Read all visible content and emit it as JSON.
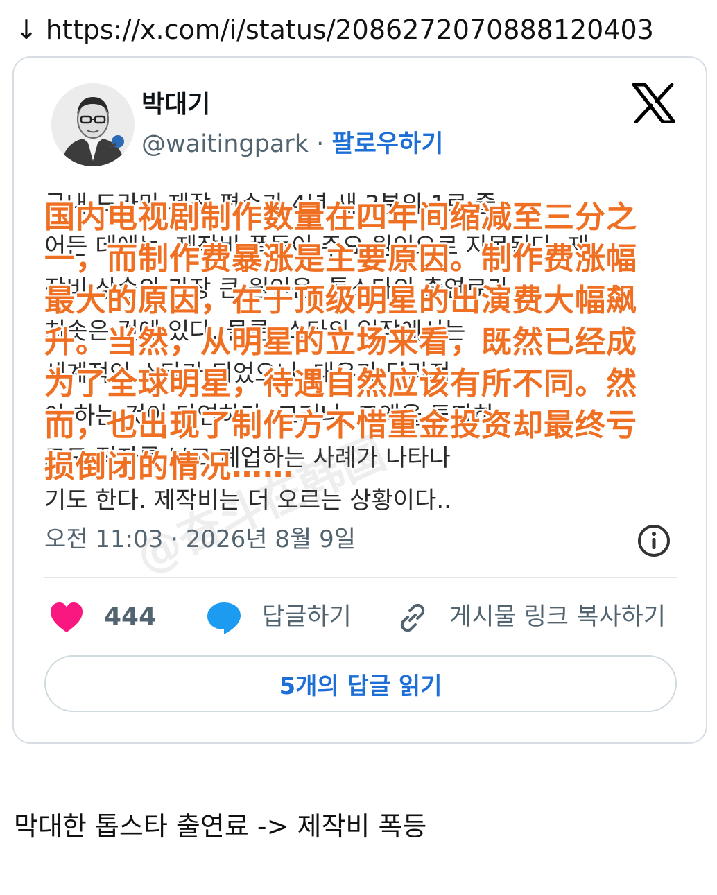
{
  "header": {
    "arrow": "↓",
    "url": "https://x.com/i/status/2086272070888120403"
  },
  "tweet": {
    "display_name": "박대기",
    "handle": "@waitingpark",
    "separator": "·",
    "follow_label": "팔로우하기",
    "background_text_lines": [
      "국내 드라마 제작 편수가 4년 새 3분의 1로 줄",
      "어든 데에는, 제작비 폭등이 주요 원인으로 지목된다. 제",
      "작비 상승의 가장 큰 원인은, 톱스타의 출연료가",
      "치솟은 것에 있다. 물론, 스타의 입장에서는",
      "세계적인 스타가 되었으니, 대우가 달라져",
      "야 하는 것이 당연하다. 그러나, 고액을 투자하",
      "고도 적자를 보고 폐업하는 사례가 나타나",
      "기도 한다. 제작비는 더 오르는 상황이다.."
    ],
    "overlay_text": "国内电视剧制作数量在四年间缩减至三分之一，而制作费暴涨是主要原因。制作费涨幅最大的原因，在于顶级明星的出演费大幅飙升。当然，从明星的立场来看，既然已经成为了全球明星，待遇自然应该有所不同。然而，也出现了制作方不惜重金投资却最终亏损倒闭的情况……",
    "timestamp": "오전 11:03 · 2026년 8월 9일",
    "like_count": "444",
    "reply_label": "답글하기",
    "copy_link_label": "게시물 링크 복사하기",
    "read_replies_label": "5개의 답글 읽기",
    "watermark": "@奋斗在韩国"
  },
  "caption": "막대한 톱스타 출연료 -> 제작비 폭등",
  "colors": {
    "overlay_text": "#f07023",
    "follow": "#1d6fd6",
    "like": "#f91880",
    "reply": "#1d9bf0",
    "muted": "#536471"
  }
}
